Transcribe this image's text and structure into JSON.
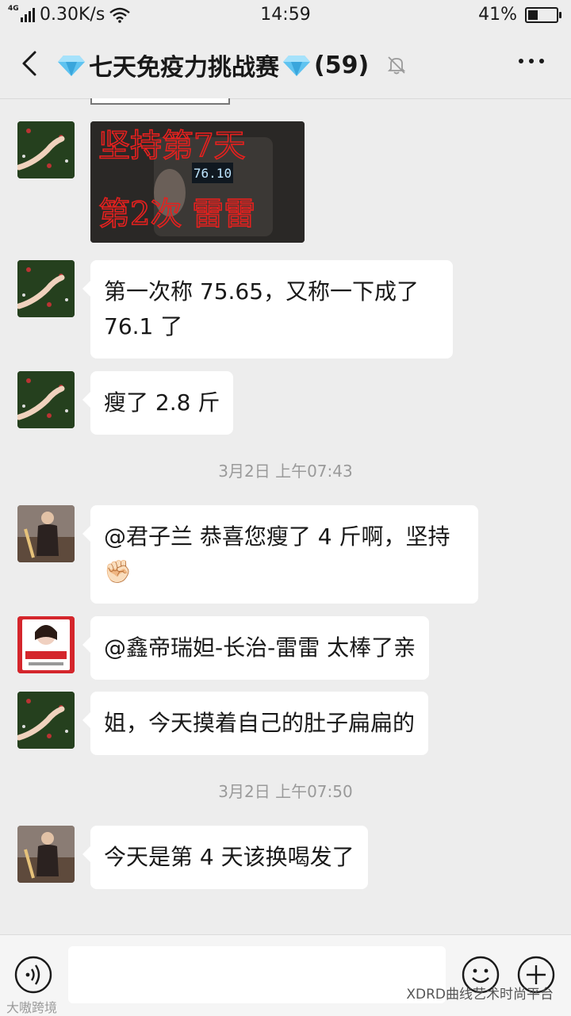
{
  "status_bar": {
    "network_type": "4G",
    "speed": "0.30K/s",
    "time": "14:59",
    "battery": "41%",
    "battery_level": 0.41
  },
  "header": {
    "back_icon": "back-arrow-icon",
    "title": "七天免疫力挑战赛",
    "member_count": "(59)",
    "gem_icon": "diamond-icon",
    "mute_icon": "mute-bell-icon",
    "more_icon": "more-dots-icon"
  },
  "messages": [
    {
      "type": "image",
      "image_text": [
        "坚持第7天",
        "第2次 雷雷"
      ],
      "scale_reading": "76.10"
    },
    {
      "type": "text",
      "text": "第一次称 75.65，又称一下成了76.1 了"
    },
    {
      "type": "text",
      "text": "瘦了 2.8 斤"
    },
    {
      "type": "time",
      "text": "3月2日 上午07:43"
    },
    {
      "type": "text",
      "text": "@君子兰  恭喜您瘦了 4 斤啊，坚持✊🏻"
    },
    {
      "type": "text",
      "text": "@鑫帝瑞妲-长治-雷雷  太棒了亲"
    },
    {
      "type": "text",
      "text": "姐，今天摸着自己的肚子扁扁的"
    },
    {
      "type": "time",
      "text": "3月2日 上午07:50"
    },
    {
      "type": "text",
      "text": "今天是第 4 天该换喝发了"
    }
  ],
  "input_bar": {
    "voice_icon": "voice-icon",
    "emoji_icon": "emoji-icon",
    "plus_icon": "plus-icon"
  },
  "watermarks": {
    "left": "大嗷跨境",
    "right": "XDRD曲线艺术时尚平台"
  },
  "colors": {
    "background": "#ededed",
    "bubble": "#ffffff",
    "timestamp": "#9a9a9a"
  }
}
